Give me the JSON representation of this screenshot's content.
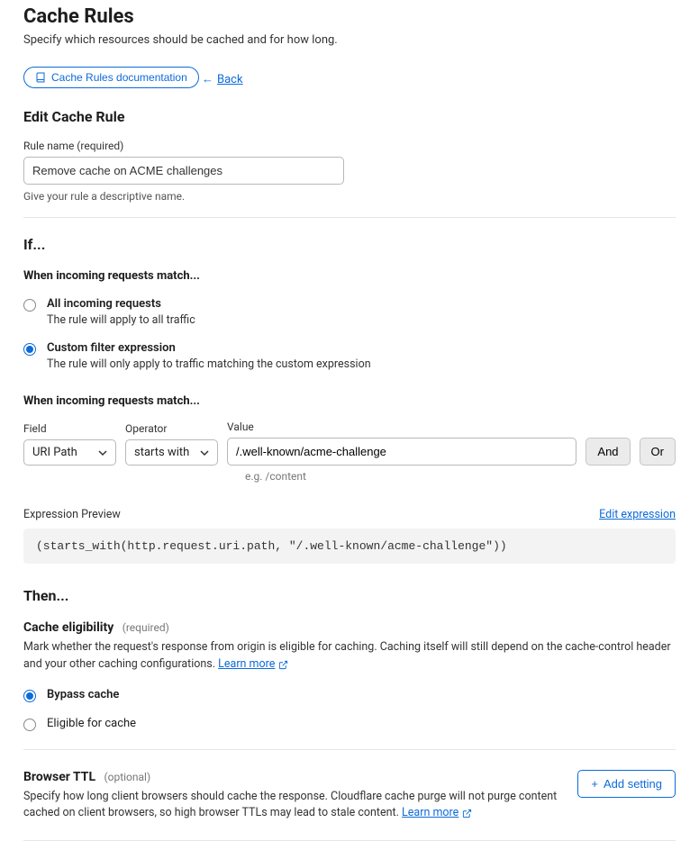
{
  "header": {
    "title": "Cache Rules",
    "subtitle": "Specify which resources should be cached and for how long.",
    "doc_button": "Cache Rules documentation",
    "back": "Back"
  },
  "edit": {
    "heading": "Edit Cache Rule",
    "rule_name_label": "Rule name (required)",
    "rule_name_value": "Remove cache on ACME challenges",
    "rule_name_helper": "Give your rule a descriptive name."
  },
  "if": {
    "heading": "If...",
    "match_heading": "When incoming requests match...",
    "radios": {
      "all": {
        "title": "All incoming requests",
        "desc": "The rule will apply to all traffic"
      },
      "custom": {
        "title": "Custom filter expression",
        "desc": "The rule will only apply to traffic matching the custom expression"
      }
    },
    "builder_heading": "When incoming requests match...",
    "cols": {
      "field": "Field",
      "operator": "Operator",
      "value": "Value"
    },
    "field_value": "URI Path",
    "operator_value": "starts with",
    "value_value": "/.well-known/acme-challenge",
    "value_hint": "e.g. /content",
    "and": "And",
    "or": "Or",
    "preview_label": "Expression Preview",
    "edit_expression": "Edit expression",
    "expression_code": "(starts_with(http.request.uri.path, \"/.well-known/acme-challenge\"))"
  },
  "then": {
    "heading": "Then...",
    "eligibility_title": "Cache eligibility",
    "required": "(required)",
    "eligibility_desc": "Mark whether the request's response from origin is eligible for caching. Caching itself will still depend on the cache-control header and your other caching configurations.",
    "learn_more": "Learn more",
    "bypass": "Bypass cache",
    "eligible": "Eligible for cache"
  },
  "ttl": {
    "title": "Browser TTL",
    "optional": "(optional)",
    "desc": "Specify how long client browsers should cache the response. Cloudflare cache purge will not purge content cached on client browsers, so high browser TTLs may lead to stale content.",
    "learn_more": "Learn more",
    "add_setting": "Add setting"
  }
}
